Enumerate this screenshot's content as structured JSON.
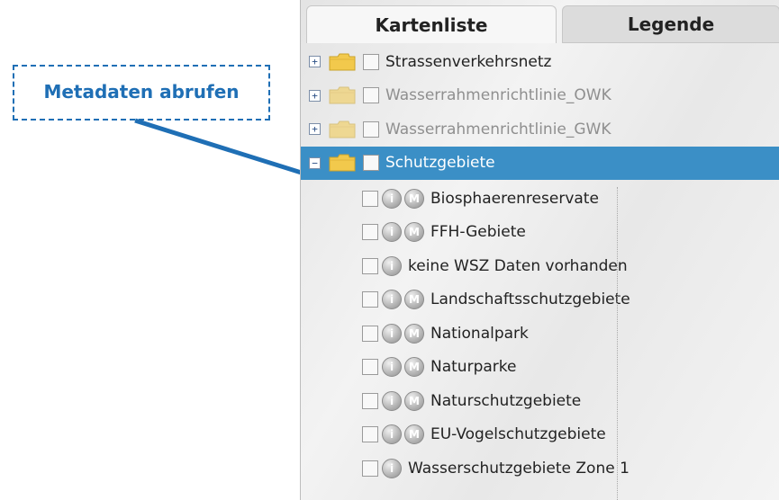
{
  "callout": {
    "text": "Metadaten abrufen",
    "color": "#1f6fb5"
  },
  "tabs": [
    {
      "label": "Kartenliste",
      "active": true
    },
    {
      "label": "Legende",
      "active": false
    }
  ],
  "tree": {
    "groups": [
      {
        "label": "Strassenverkehrsnetz",
        "expander": "+",
        "dim": false
      },
      {
        "label": "Wasserrahmenrichtlinie_OWK",
        "expander": "+",
        "dim": true
      },
      {
        "label": "Wasserrahmenrichtlinie_GWK",
        "expander": "+",
        "dim": true
      },
      {
        "label": "Schutzgebiete",
        "expander": "−",
        "dim": false,
        "selected": true
      }
    ],
    "layers": [
      {
        "label": "Biosphaerenreservate",
        "buttons": [
          "i",
          "M"
        ]
      },
      {
        "label": "FFH-Gebiete",
        "buttons": [
          "i",
          "M"
        ]
      },
      {
        "label": "keine WSZ Daten vorhanden",
        "buttons": [
          "i"
        ]
      },
      {
        "label": "Landschaftsschutzgebiete",
        "buttons": [
          "i",
          "M"
        ]
      },
      {
        "label": "Nationalpark",
        "buttons": [
          "i",
          "M"
        ]
      },
      {
        "label": "Naturparke",
        "buttons": [
          "i",
          "M"
        ]
      },
      {
        "label": "Naturschutzgebiete",
        "buttons": [
          "i",
          "M"
        ]
      },
      {
        "label": "EU-Vogelschutzgebiete",
        "buttons": [
          "i",
          "M"
        ]
      },
      {
        "label": "Wasserschutzgebiete Zone 1",
        "buttons": [
          "i"
        ]
      }
    ]
  },
  "colors": {
    "selected_row": "#3b8fc6",
    "folder": "#f2c94c"
  }
}
